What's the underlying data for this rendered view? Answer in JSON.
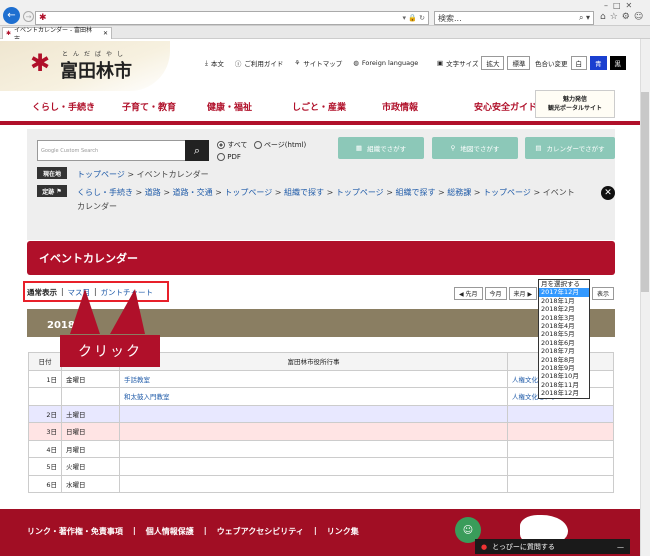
{
  "browser": {
    "address_text": "",
    "search_placeholder": "検索...",
    "tab_title": "イベントカレンダー - 富田林市..."
  },
  "site": {
    "logo_ruby": "とんだばやし",
    "logo_text": "富田林市",
    "util": [
      "本文",
      "ご利用ガイド",
      "サイトマップ",
      "Foreign language"
    ],
    "font_size_label": "文字サイズ",
    "font_btns": [
      "拡大",
      "標準"
    ],
    "color_label": "色合い変更",
    "color_btns": [
      "白",
      "青",
      "黒"
    ],
    "banner_line1": "魅力発信",
    "banner_line2": "観光ポータルサイト",
    "nav": [
      "くらし・手続き",
      "子育て・教育",
      "健康・福祉",
      "しごと・産業",
      "市政情報",
      "安心安全ガイド"
    ]
  },
  "search": {
    "google_placeholder": "Google Custom Search",
    "options": [
      "すべて",
      "ページ(html)",
      "PDF"
    ],
    "buttons": [
      "組織でさがす",
      "地図でさがす",
      "カレンダーでさがす"
    ]
  },
  "breadcrumb": {
    "now_label": "現在地",
    "now_items": [
      "トップページ",
      "イベントカレンダー"
    ],
    "fixed_label": "定跡",
    "fixed_items": [
      "くらし・手続き",
      "道路",
      "道路・交通",
      "トップページ",
      "組織で探す",
      "トップページ",
      "組織で探す",
      "総務課",
      "トップページ"
    ],
    "fixed_tail": "イベント",
    "fixed_tail2": "カレンダー"
  },
  "section_title": "イベントカレンダー",
  "views": {
    "current": "通常表示",
    "mass": "マス目",
    "gantt": "ガントチャート",
    "sep": "|"
  },
  "month_nav": [
    "◀ 先月",
    "今月",
    "来月 ▶"
  ],
  "show_btn": "表示",
  "month_select": {
    "options": [
      "月を選択する",
      "2017年12月",
      "2018年1月",
      "2018年2月",
      "2018年3月",
      "2018年4月",
      "2018年5月",
      "2018年6月",
      "2018年7月",
      "2018年8月",
      "2018年9月",
      "2018年10月",
      "2018年11月",
      "2018年12月"
    ],
    "selected": 1
  },
  "month_heading": "2018年",
  "callout": "クリック",
  "table": {
    "headers": [
      "日付",
      "富田林市役所行事"
    ],
    "rows": [
      {
        "day": "1日",
        "weekday": "金曜日",
        "event": "手話教室",
        "place": "人権文化"
      },
      {
        "day": "",
        "weekday": "",
        "event": "和太鼓入門教室",
        "place": "人権文化センター"
      },
      {
        "day": "2日",
        "weekday": "土曜日",
        "event": "",
        "place": ""
      },
      {
        "day": "3日",
        "weekday": "日曜日",
        "event": "",
        "place": ""
      },
      {
        "day": "4日",
        "weekday": "月曜日",
        "event": "",
        "place": ""
      },
      {
        "day": "5日",
        "weekday": "火曜日",
        "event": "",
        "place": ""
      },
      {
        "day": "6日",
        "weekday": "水曜日",
        "event": "",
        "place": ""
      }
    ]
  },
  "footer": {
    "links": [
      "リンク・著作権・免責事項",
      "個人情報保護",
      "ウェブアクセシビリティ",
      "リンク集"
    ],
    "popup": "とっぴーに質問する"
  },
  "colors": {
    "brand_red": "#b0102a",
    "teal": "#8cc8b8",
    "sat_bg": "#e8e8ff",
    "sun_bg": "#ffe4e4",
    "annotation": "#e8202a"
  }
}
